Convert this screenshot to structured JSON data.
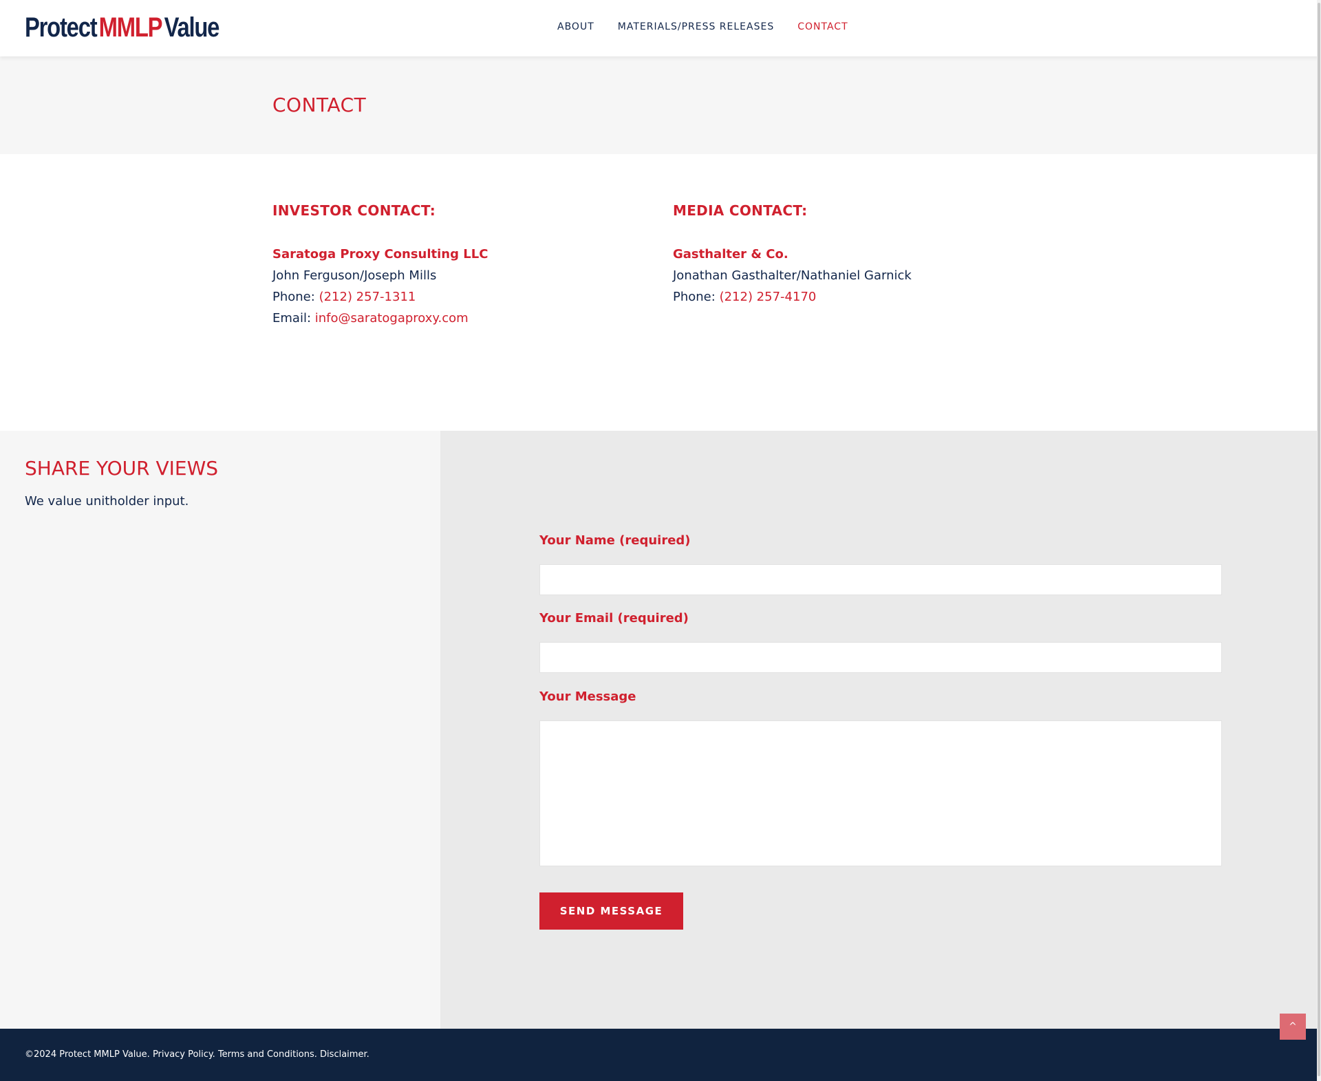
{
  "header": {
    "logo": {
      "part1": "Protect",
      "part2": "MMLP",
      "part3": "Value"
    },
    "nav": [
      {
        "label": "ABOUT",
        "active": false
      },
      {
        "label": "MATERIALS/PRESS RELEASES",
        "active": false
      },
      {
        "label": "CONTACT",
        "active": true
      }
    ]
  },
  "page": {
    "title": "CONTACT"
  },
  "contacts": {
    "investor": {
      "heading": "INVESTOR CONTACT:",
      "company": "Saratoga Proxy Consulting LLC",
      "names": "John Ferguson/Joseph Mills",
      "phone_label": "Phone:",
      "phone": "(212) 257-1311",
      "email_label": "Email:",
      "email": "info@saratogaproxy.com"
    },
    "media": {
      "heading": "MEDIA CONTACT:",
      "company": "Gasthalter & Co.",
      "names": "Jonathan Gasthalter/Nathaniel Garnick",
      "phone_label": "Phone:",
      "phone": "(212) 257-4170"
    }
  },
  "share": {
    "title": "SHARE YOUR VIEWS",
    "subtitle": "We value unitholder input."
  },
  "form": {
    "name_label": "Your Name (required)",
    "name_value": "",
    "email_label": "Your Email (required)",
    "email_value": "",
    "message_label": "Your Message",
    "message_value": "",
    "submit_label": "SEND MESSAGE"
  },
  "footer": {
    "copyright": "©2024 Protect MMLP Value.",
    "privacy": "Privacy Policy.",
    "terms": "Terms and Conditions.",
    "disclaimer": "Disclaimer."
  },
  "back_to_top": {
    "icon": "chevron-up-icon",
    "glyph": "^"
  },
  "colors": {
    "brand_red": "#d0202e",
    "navy": "#12264a",
    "footer_bg": "#10233f",
    "light_bg": "#f6f6f6",
    "form_bg": "#eaeaea"
  }
}
